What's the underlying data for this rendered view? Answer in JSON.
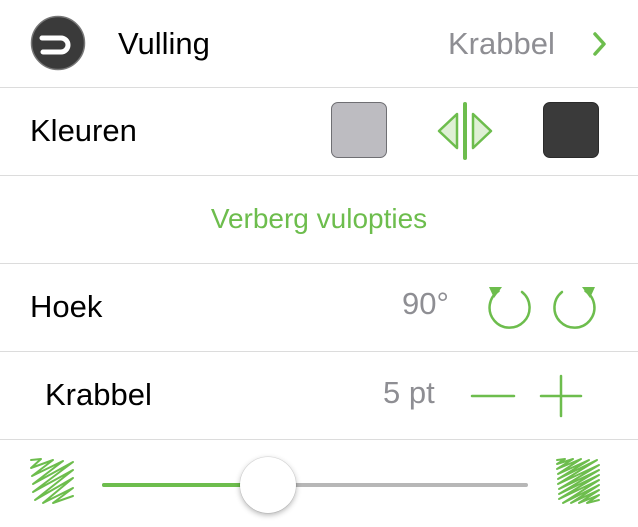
{
  "colors": {
    "accent": "#6dbd4d",
    "secondary_text": "#8e8e93",
    "separator": "#dcdcdc",
    "swatch_start": "#bdbcc1",
    "swatch_end": "#3a3a3a",
    "track_inactive": "#b7b7b7"
  },
  "fill_row": {
    "label": "Vulling",
    "value": "Krabbel",
    "icon": "fill-style-icon",
    "disclosure_icon": "chevron-right-icon"
  },
  "colors_row": {
    "label": "Kleuren",
    "swap_icon": "swap-colors-icon"
  },
  "hide_options": {
    "label": "Verberg vulopties"
  },
  "angle_row": {
    "label": "Hoek",
    "value": "90°",
    "rotate_ccw_icon": "rotate-left-icon",
    "rotate_cw_icon": "rotate-right-icon"
  },
  "scribble_row": {
    "label": "Krabbel",
    "value": "5 pt",
    "decrease_icon": "minus-icon",
    "increase_icon": "plus-icon"
  },
  "density_slider": {
    "value_fraction": 0.39,
    "min_icon": "sparse-scribble-icon",
    "max_icon": "dense-scribble-icon"
  }
}
